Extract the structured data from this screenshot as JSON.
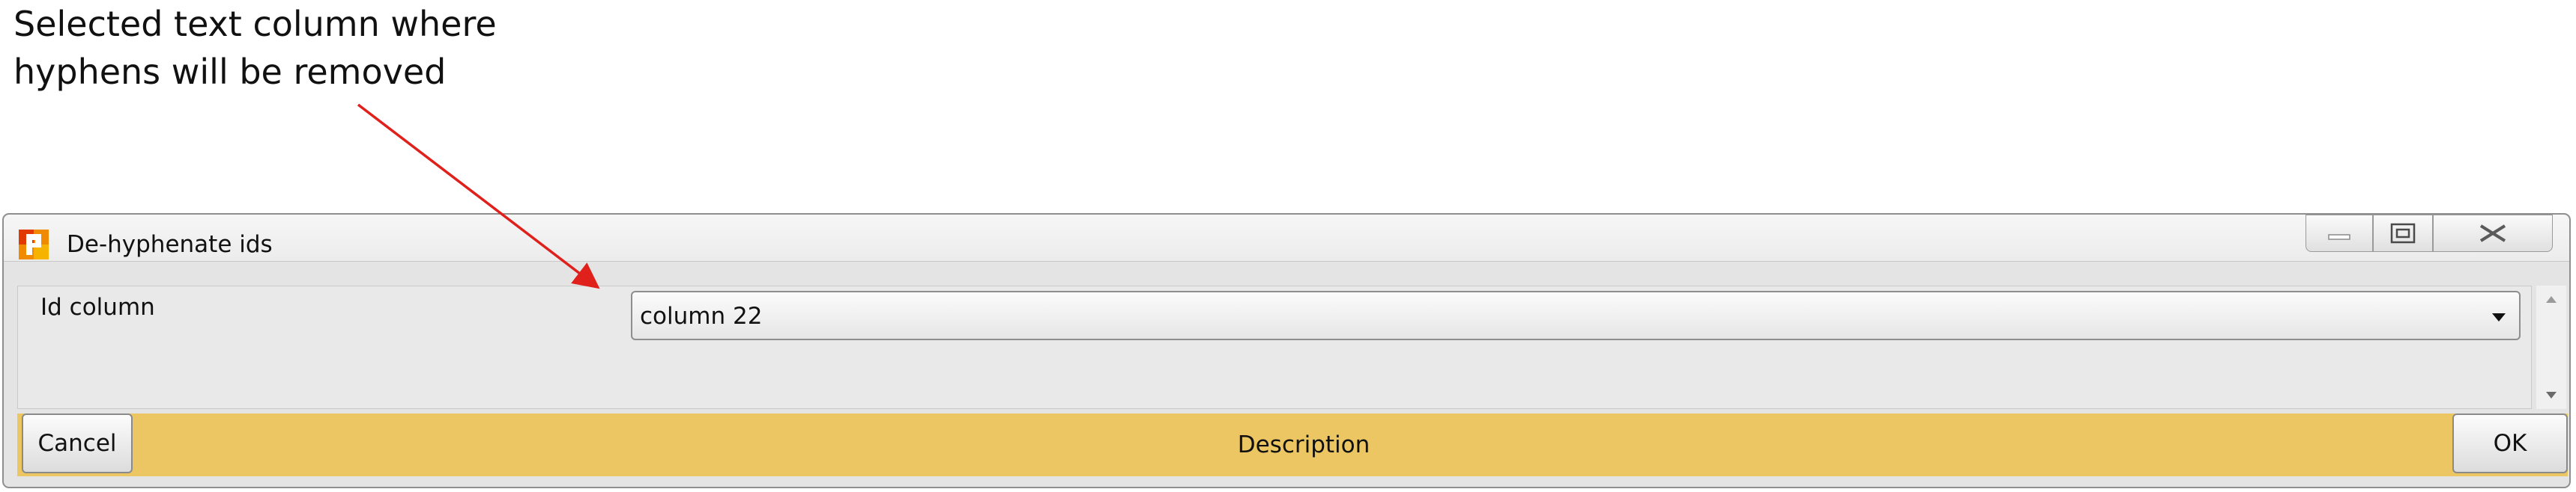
{
  "annotation": {
    "text": "Selected text column where\nhyphens will be removed",
    "arrow_color": "#e0201b"
  },
  "window": {
    "title": "De-hyphenate ids",
    "icon": "app-logo-icon",
    "controls": {
      "minimize_icon": "minimize-icon",
      "maximize_icon": "maximize-icon",
      "close_icon": "close-icon"
    }
  },
  "form": {
    "id_column_label": "Id column",
    "id_column_value": "column 22"
  },
  "footer": {
    "cancel_label": "Cancel",
    "description_label": "Description",
    "ok_label": "OK",
    "bar_color": "#ebc663"
  }
}
